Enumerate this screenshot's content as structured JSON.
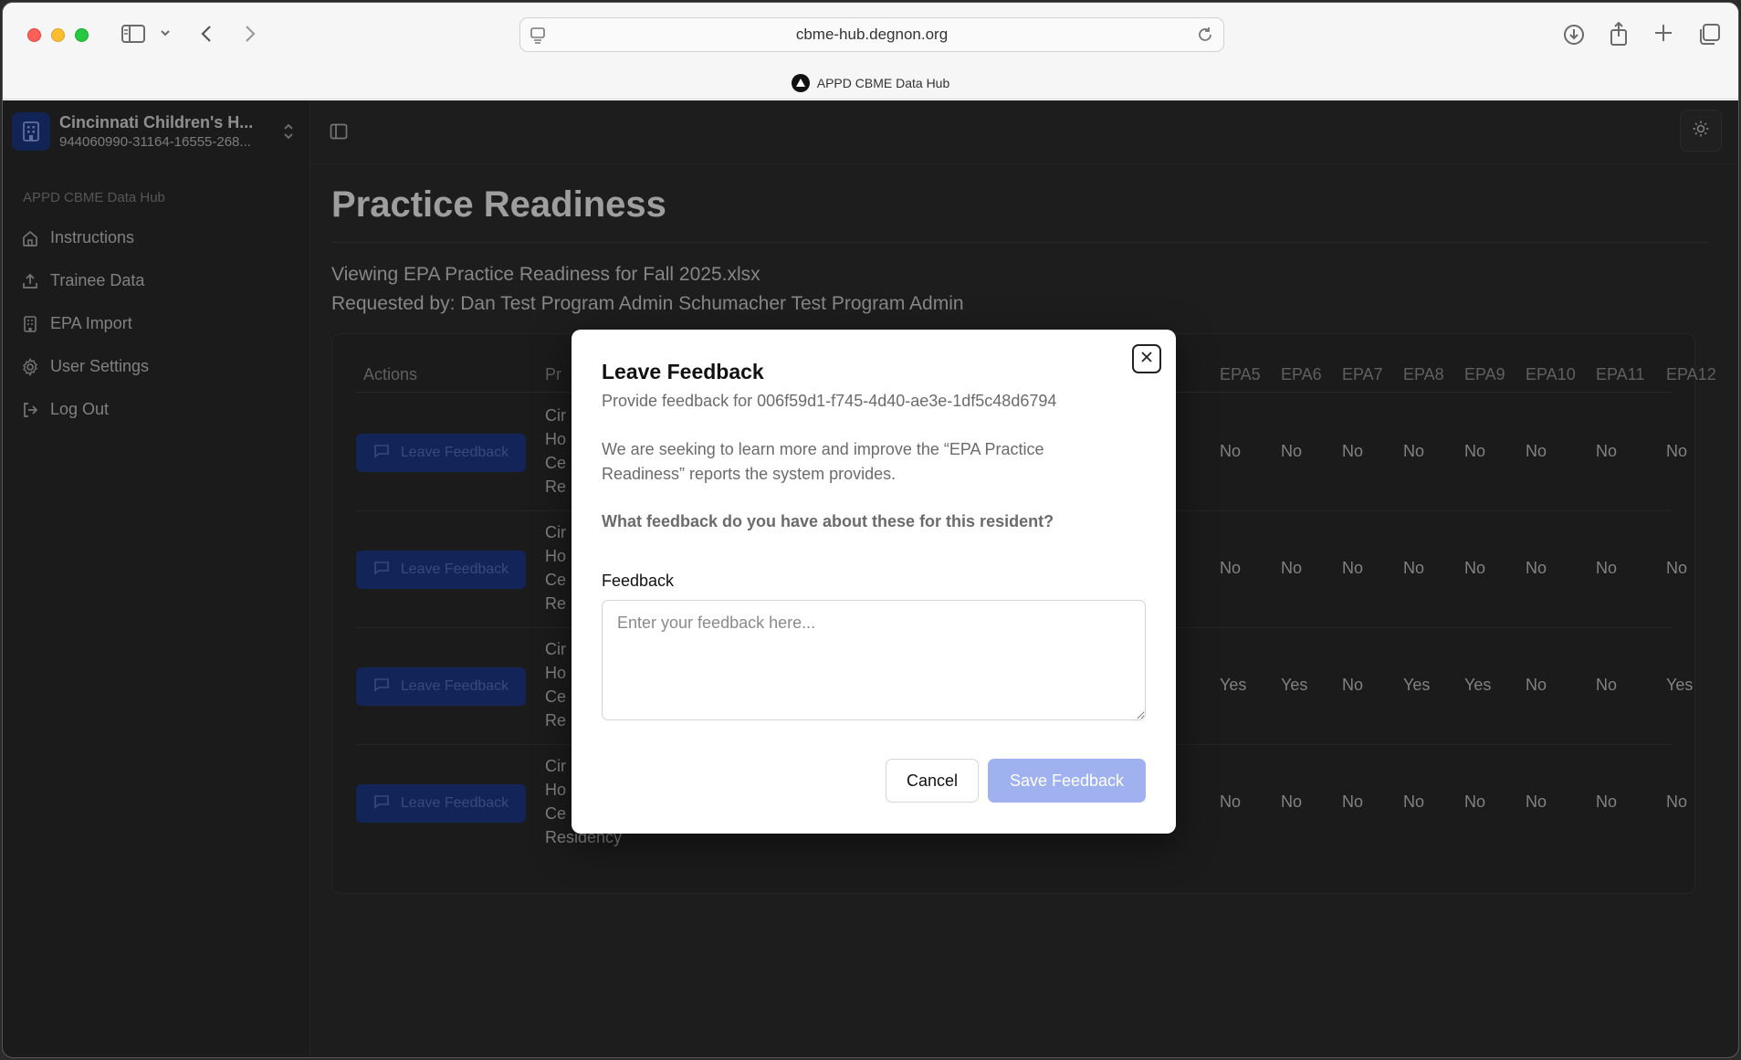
{
  "browser": {
    "url": "cbme-hub.degnon.org",
    "tab_title": "APPD CBME Data Hub"
  },
  "sidebar": {
    "org_name": "Cincinnati Children's H...",
    "org_id": "944060990-31164-16555-268...",
    "section_heading": "APPD CBME Data Hub",
    "items": [
      {
        "label": "Instructions",
        "icon": "home-icon"
      },
      {
        "label": "Trainee Data",
        "icon": "upload-icon"
      },
      {
        "label": "EPA Import",
        "icon": "building-icon"
      },
      {
        "label": "User Settings",
        "icon": "gear-icon"
      },
      {
        "label": "Log Out",
        "icon": "logout-icon"
      }
    ]
  },
  "main": {
    "title": "Practice Readiness",
    "viewing": "Viewing EPA Practice Readiness for Fall 2025.xlsx",
    "requested_by": "Requested by: Dan Test Program Admin Schumacher Test Program Admin"
  },
  "table": {
    "headers": {
      "actions": "Actions",
      "program": "Pr",
      "epas": [
        "EPA5",
        "EPA6",
        "EPA7",
        "EPA8",
        "EPA9",
        "EPA10",
        "EPA11",
        "EPA12"
      ]
    },
    "row_button_label": "Leave Feedback",
    "rows": [
      {
        "program": [
          "Cir",
          "Ho",
          "Ce",
          "Re"
        ],
        "epas": [
          "No",
          "No",
          "No",
          "No",
          "No",
          "No",
          "No",
          "No"
        ]
      },
      {
        "program": [
          "Cir",
          "Ho",
          "Ce",
          "Re"
        ],
        "epas": [
          "No",
          "No",
          "No",
          "No",
          "No",
          "No",
          "No",
          "No"
        ]
      },
      {
        "program": [
          "Cir",
          "Ho",
          "Ce",
          "Re"
        ],
        "epas": [
          "Yes",
          "Yes",
          "No",
          "Yes",
          "Yes",
          "No",
          "No",
          "Yes"
        ]
      },
      {
        "program": [
          "Cir",
          "Ho",
          "Ce",
          "Residency"
        ],
        "epas": [
          "No",
          "No",
          "No",
          "No",
          "No",
          "No",
          "No",
          "No"
        ]
      }
    ]
  },
  "dialog": {
    "title": "Leave Feedback",
    "description": "Provide feedback for 006f59d1-f745-4d40-ae3e-1df5c48d6794",
    "body": "We are seeking to learn more and improve the “EPA Practice Readiness” reports the system provides.",
    "question": "What feedback do you have about these for this resident?",
    "field_label": "Feedback",
    "field_placeholder": "Enter your feedback here...",
    "field_value": "",
    "cancel_label": "Cancel",
    "save_label": "Save Feedback"
  }
}
